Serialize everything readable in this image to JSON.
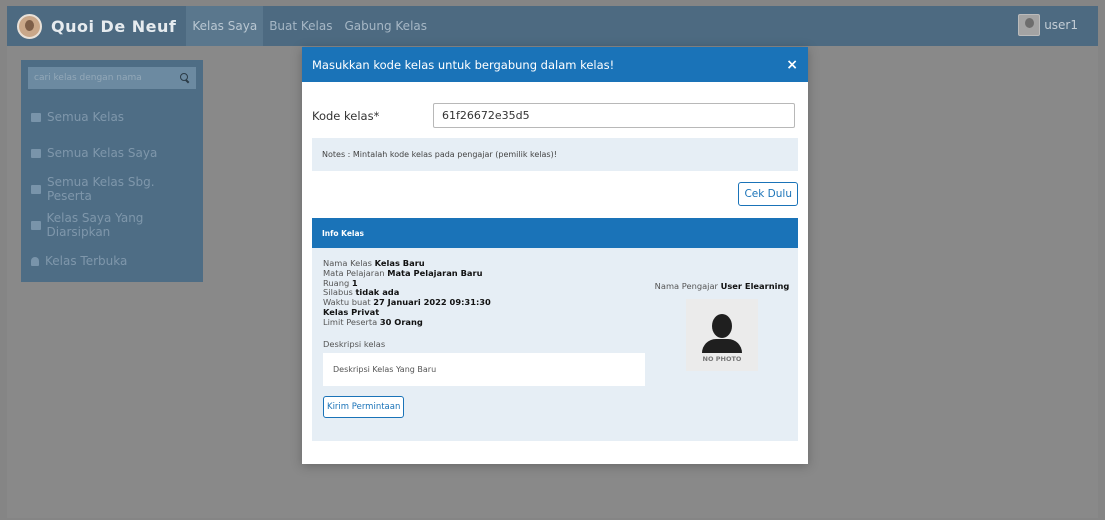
{
  "navbar": {
    "brand": "Quoi De Neuf",
    "links": [
      "Kelas Saya",
      "Buat Kelas",
      "Gabung Kelas"
    ],
    "username": "user1"
  },
  "sidebar": {
    "search_placeholder": "cari kelas dengan nama",
    "items": [
      "Semua Kelas",
      "Semua Kelas Saya",
      "Semua Kelas Sbg. Peserta",
      "Kelas Saya Yang Diarsipkan",
      "Kelas Terbuka"
    ]
  },
  "modal": {
    "title": "Masukkan kode kelas untuk bergabung dalam kelas!",
    "close": "×",
    "code_label": "Kode kelas*",
    "code_value": "61f26672e35d5",
    "notes": "Notes : Mintalah kode kelas pada pengajar (pemilik kelas)!",
    "check_button": "Cek Dulu",
    "info_header": "Info Kelas",
    "info": {
      "nama_kelas_label": "Nama Kelas",
      "nama_kelas": "Kelas Baru",
      "mapel_label": "Mata Pelajaran",
      "mapel": "Mata Pelajaran Baru",
      "ruang_label": "Ruang",
      "ruang": "1",
      "silabus_label": "Silabus",
      "silabus": "tidak ada",
      "waktu_label": "Waktu buat",
      "waktu": "27 Januari 2022 09:31:30",
      "privat": "Kelas Privat",
      "limit_label": "Limit Peserta",
      "limit": "30 Orang",
      "desc_label": "Deskripsi kelas",
      "desc": "Deskripsi Kelas Yang Baru",
      "teacher_label": "Nama Pengajar",
      "teacher": "User Elearning",
      "photo_label": "NO PHOTO"
    },
    "send_button": "Kirim Permintaan"
  }
}
